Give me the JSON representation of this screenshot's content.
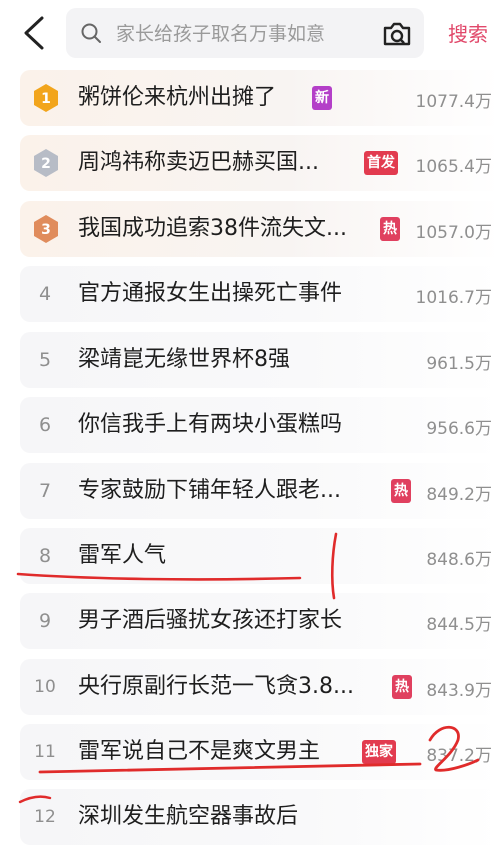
{
  "search": {
    "placeholder": "家长给孩子取名万事如意",
    "button_label": "搜索"
  },
  "colors": {
    "accent": "#e1486a",
    "badge_new": "#b43fc8",
    "badge_first": "#e23b4f",
    "badge_hot": "#e0405f",
    "badge_exclusive": "#e23b4f",
    "medal_gold": "#f2a51c",
    "medal_silver": "#b7bcc6",
    "medal_bronze": "#e08c5c",
    "annotation": "#e02b2b"
  },
  "items": [
    {
      "rank": "1",
      "title": "粥饼伦来杭州出摊了",
      "badge": "新",
      "badge_type": "new",
      "count": "1077.4万",
      "medal": "gold"
    },
    {
      "rank": "2",
      "title": "周鸿祎称卖迈巴赫买国...",
      "badge": "首发",
      "badge_type": "first",
      "count": "1065.4万",
      "medal": "silver"
    },
    {
      "rank": "3",
      "title": "我国成功追索38件流失文...",
      "badge": "热",
      "badge_type": "hot",
      "count": "1057.0万",
      "medal": "bronze"
    },
    {
      "rank": "4",
      "title": "官方通报女生出操死亡事件",
      "badge": "",
      "badge_type": "",
      "count": "1016.7万",
      "medal": ""
    },
    {
      "rank": "5",
      "title": "梁靖崑无缘世界杯8强",
      "badge": "",
      "badge_type": "",
      "count": "961.5万",
      "medal": ""
    },
    {
      "rank": "6",
      "title": "你信我手上有两块小蛋糕吗",
      "badge": "",
      "badge_type": "",
      "count": "956.6万",
      "medal": ""
    },
    {
      "rank": "7",
      "title": "专家鼓励下铺年轻人跟老...",
      "badge": "热",
      "badge_type": "hot",
      "count": "849.2万",
      "medal": ""
    },
    {
      "rank": "8",
      "title": "雷军人气",
      "badge": "",
      "badge_type": "",
      "count": "848.6万",
      "medal": ""
    },
    {
      "rank": "9",
      "title": "男子酒后骚扰女孩还打家长",
      "badge": "",
      "badge_type": "",
      "count": "844.5万",
      "medal": ""
    },
    {
      "rank": "10",
      "title": "央行原副行长范一飞贪3.8...",
      "badge": "热",
      "badge_type": "hot",
      "count": "843.9万",
      "medal": ""
    },
    {
      "rank": "11",
      "title": "雷军说自己不是爽文男主",
      "badge": "独家",
      "badge_type": "exclusive",
      "count": "837.2万",
      "medal": ""
    },
    {
      "rank": "12",
      "title": "深圳发生航空器事故后",
      "badge": "",
      "badge_type": "",
      "count": "",
      "medal": ""
    }
  ]
}
